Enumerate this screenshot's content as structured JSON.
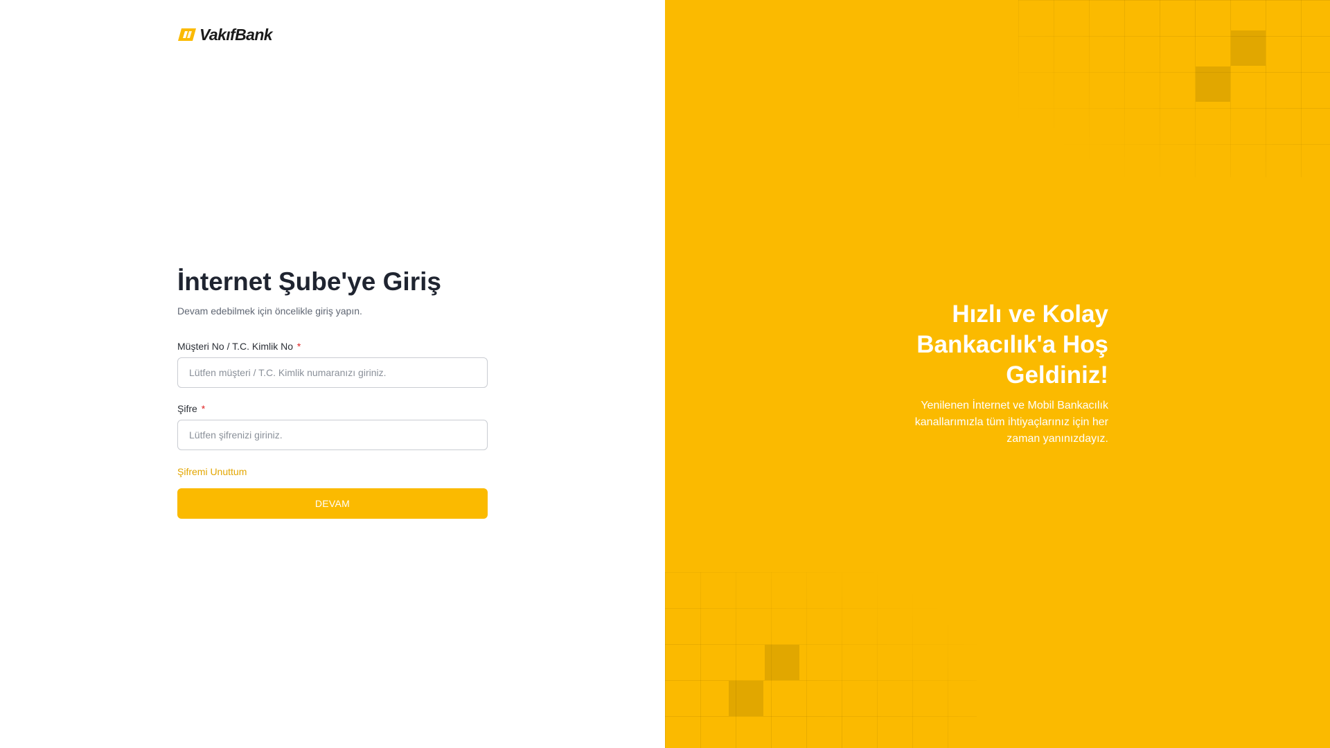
{
  "brand": {
    "name": "VakıfBank",
    "accent_color": "#fbba00",
    "logo_icon": "vakifbank-logo-icon"
  },
  "login": {
    "title": "İnternet Şube'ye Giriş",
    "subtitle": "Devam edebilmek için öncelikle giriş yapın.",
    "customer_field": {
      "label": "Müşteri No / T.C. Kimlik No",
      "required_mark": "*",
      "value": "",
      "placeholder": "Lütfen müşteri / T.C. Kimlik numaranızı giriniz."
    },
    "password_field": {
      "label": "Şifre",
      "required_mark": "*",
      "value": "",
      "placeholder": "Lütfen şifrenizi giriniz."
    },
    "forgot_password_label": "Şifremi Unuttum",
    "submit_label": "DEVAM"
  },
  "welcome": {
    "title": "Hızlı ve Kolay Bankacılık'a Hoş Geldiniz!",
    "text": "Yenilenen İnternet ve Mobil Bankacılık kanallarımızla tüm ihtiyaçlarınız için her zaman yanınızdayız."
  }
}
